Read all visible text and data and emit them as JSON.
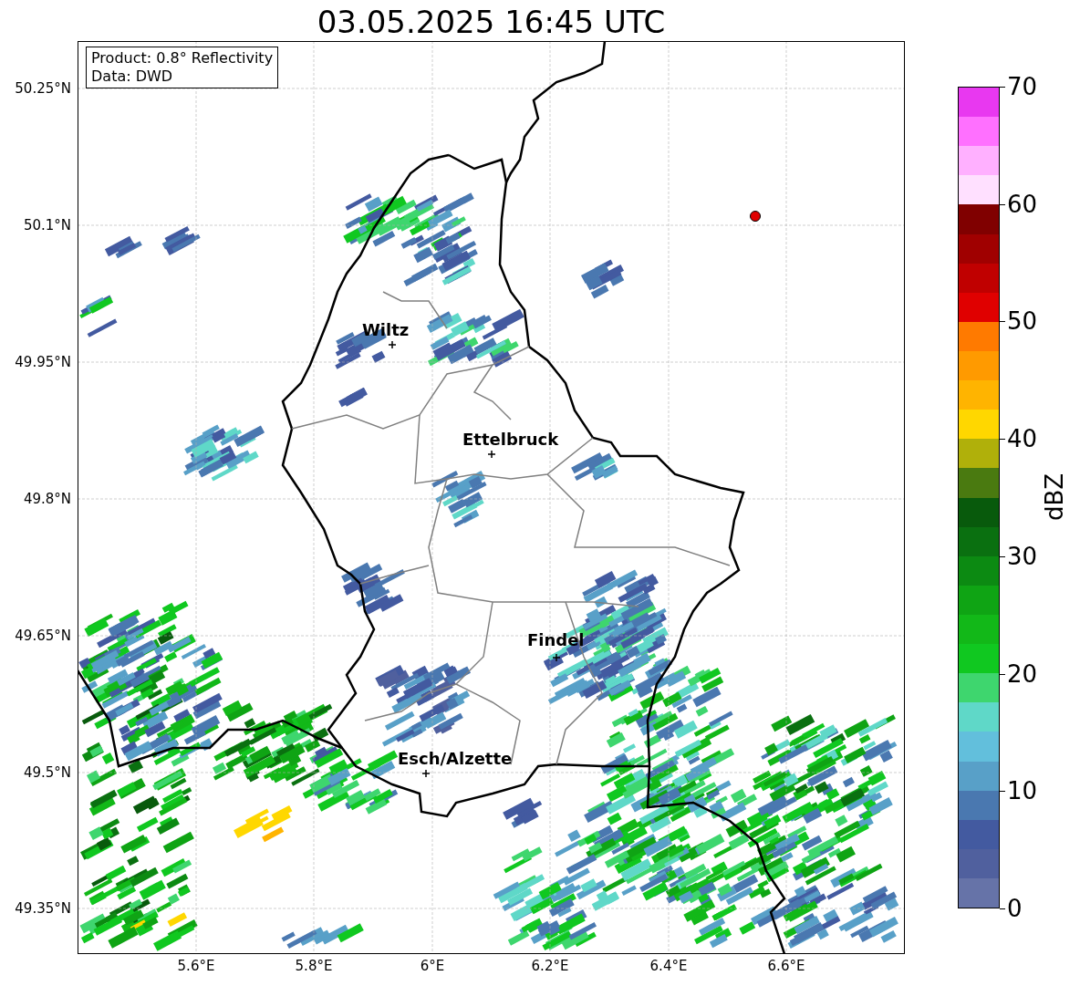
{
  "title": "03.05.2025 16:45 UTC",
  "info_box": [
    "Product: 0.8° Reflectivity",
    "Data: DWD"
  ],
  "lat_ticks": [
    "50.25°N",
    "50.1°N",
    "49.95°N",
    "49.8°N",
    "49.65°N",
    "49.5°N",
    "49.35°N"
  ],
  "lon_ticks": [
    "5.6°E",
    "5.8°E",
    "6°E",
    "6.2°E",
    "6.4°E",
    "6.6°E"
  ],
  "cities": [
    {
      "name": "Wiltz"
    },
    {
      "name": "Ettelbruck"
    },
    {
      "name": "Findel"
    },
    {
      "name": "Esch/Alzette"
    }
  ],
  "colorbar": {
    "label": "dBZ",
    "ticks": [
      "70",
      "60",
      "50",
      "40",
      "30",
      "20",
      "10",
      "0"
    ],
    "segments": [
      {
        "color": "#e838f0"
      },
      {
        "color": "#ff70ff"
      },
      {
        "color": "#ffb0ff"
      },
      {
        "color": "#ffe0ff"
      },
      {
        "color": "#800000"
      },
      {
        "color": "#a00000"
      },
      {
        "color": "#c00000"
      },
      {
        "color": "#e00000"
      },
      {
        "color": "#ff7a00"
      },
      {
        "color": "#ff9a00"
      },
      {
        "color": "#ffb400"
      },
      {
        "color": "#ffd700"
      },
      {
        "color": "#b0b00a"
      },
      {
        "color": "#4a7a10"
      },
      {
        "color": "#085a0c"
      },
      {
        "color": "#0a7010"
      },
      {
        "color": "#0c8a12"
      },
      {
        "color": "#0fa414"
      },
      {
        "color": "#12b818"
      },
      {
        "color": "#10c820"
      },
      {
        "color": "#3ed66e"
      },
      {
        "color": "#5fd8c8"
      },
      {
        "color": "#62bfdc"
      },
      {
        "color": "#58a0c8"
      },
      {
        "color": "#4a78b0"
      },
      {
        "color": "#435aa0"
      },
      {
        "color": "#50609e"
      },
      {
        "color": "#6673a8"
      }
    ]
  }
}
